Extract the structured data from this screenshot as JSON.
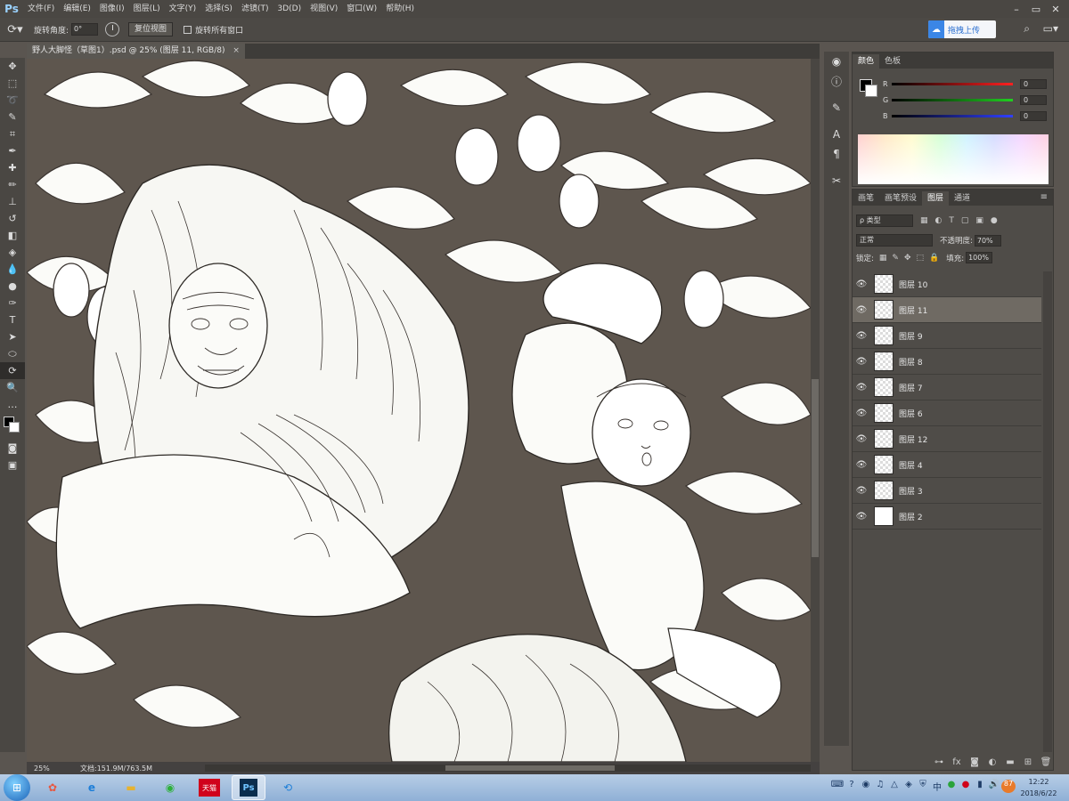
{
  "app": {
    "logo": "Ps",
    "menu": [
      "文件(F)",
      "编辑(E)",
      "图像(I)",
      "图层(L)",
      "文字(Y)",
      "选择(S)",
      "滤镜(T)",
      "3D(D)",
      "视图(V)",
      "窗口(W)",
      "帮助(H)"
    ],
    "window_controls": [
      "–",
      "▭",
      "✕"
    ]
  },
  "options_bar": {
    "rotate_label": "旋转角度:",
    "rotate_value": "0°",
    "reset_view": "复位视图",
    "rotate_all_windows": "旋转所有窗口",
    "cloud_upload": "拖拽上传"
  },
  "document": {
    "tab_title": "野人大脚怪（草图1）.psd @ 25% (图层 11, RGB/8)",
    "tab_close": "×",
    "zoom": "25%",
    "doc_size": "文档:151.9M/763.5M"
  },
  "color_panel": {
    "tabs": [
      "颜色",
      "色板"
    ],
    "active_tab": "颜色",
    "channels": [
      {
        "name": "R",
        "value": "0",
        "color": "#ff2020"
      },
      {
        "name": "G",
        "value": "0",
        "color": "#20d020"
      },
      {
        "name": "B",
        "value": "0",
        "color": "#3040ff"
      }
    ]
  },
  "layers_panel": {
    "tabs": [
      "画笔",
      "画笔预设",
      "图层",
      "通道"
    ],
    "active_tab": "图层",
    "filter": "ρ 类型",
    "blend_mode": "正常",
    "opacity_label": "不透明度:",
    "opacity_value": "70%",
    "lock_label": "锁定:",
    "fill_label": "填充:",
    "fill_value": "100%",
    "layers": [
      {
        "name": "图层 10",
        "selected": false,
        "white": false
      },
      {
        "name": "图层 11",
        "selected": true,
        "white": false
      },
      {
        "name": "图层 9",
        "selected": false,
        "white": false
      },
      {
        "name": "图层 8",
        "selected": false,
        "white": false
      },
      {
        "name": "图层 7",
        "selected": false,
        "white": false
      },
      {
        "name": "图层 6",
        "selected": false,
        "white": false
      },
      {
        "name": "图层 12",
        "selected": false,
        "white": false
      },
      {
        "name": "图层 4",
        "selected": false,
        "white": false
      },
      {
        "name": "图层 3",
        "selected": false,
        "white": false
      },
      {
        "name": "图层 2",
        "selected": false,
        "white": true
      }
    ]
  },
  "taskbar": {
    "tmall_label": "天猫",
    "ps_label": "Ps",
    "tray_badge": "87",
    "time": "12:22",
    "date": "2018/6/22"
  }
}
